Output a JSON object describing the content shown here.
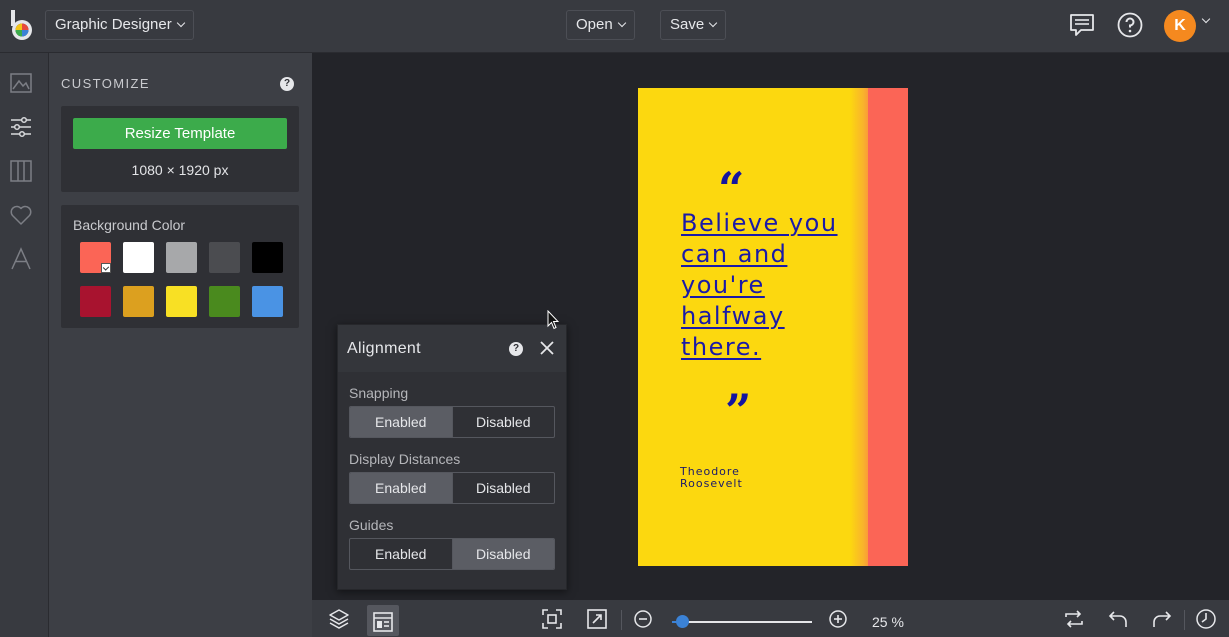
{
  "app": {
    "name_menu": "Graphic Designer",
    "open_label": "Open",
    "save_label": "Save",
    "avatar_initial": "K",
    "brand_color": "#3cab4b",
    "avatar_color": "#f5891f"
  },
  "sidebar_rail": {
    "icons": [
      "image-icon",
      "sliders-icon",
      "columns-icon",
      "heart-icon",
      "text-icon"
    ]
  },
  "customize": {
    "title": "CUSTOMIZE",
    "resize_button": "Resize Template",
    "dimensions": "1080 × 1920 px",
    "background_label": "Background Color",
    "swatches": [
      "#fb6556",
      "#ffffff",
      "#a7a8aa",
      "#4b4c50",
      "#000000",
      "#a8132f",
      "#dca01f",
      "#f8e024",
      "#4a8a1e",
      "#4a93e4"
    ],
    "selected_swatch": "#fb6556"
  },
  "alignment": {
    "title": "Alignment",
    "snapping_label": "Snapping",
    "distances_label": "Display Distances",
    "guides_label": "Guides",
    "enabled": "Enabled",
    "disabled": "Disabled",
    "snapping_value": "Enabled",
    "distances_value": "Enabled",
    "guides_value": "Disabled"
  },
  "poster": {
    "quote": "Believe you can and you're halfway there.",
    "author_line1": "Theodore",
    "author_line2": "Roosevelt",
    "open_quote": "“",
    "close_quote": "”",
    "bg_color": "#fcd80f",
    "accent_color": "#fb6556",
    "text_color": "#1a1aa8"
  },
  "bottombar": {
    "zoom": "25 %",
    "zoom_fraction": 0.07
  }
}
